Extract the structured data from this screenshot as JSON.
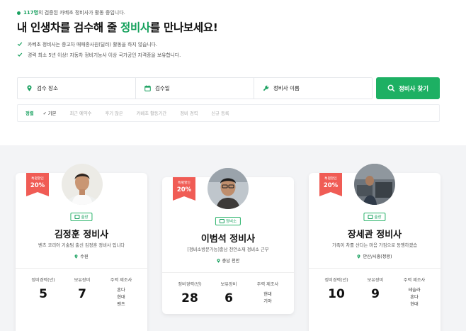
{
  "header": {
    "count_number": "117명",
    "count_suffix": "의 검증된 카베초 정비사가 활동 중입니다.",
    "headline_pre": "내 인생차를 검수해 줄 ",
    "headline_highlight": "정비사",
    "headline_post": "를 만나보세요!",
    "checks": [
      "카베초 정비사는 중고차 매매종사원(딜러) 활동을 하지 않습니다.",
      "경력 최소 5년 이상! 자동차 정비기능사 이상 국가공인 자격증을 보유합니다."
    ]
  },
  "search": {
    "location_label": "검수 장소",
    "date_label": "검수일",
    "name_label": "정비사 이름",
    "button_label": "정비사 찾기"
  },
  "sort": {
    "label": "정렬",
    "options": [
      "기본",
      "최근 예약수",
      "후기 많은",
      "카베초 활동기간",
      "정비 경력",
      "신규 등록"
    ]
  },
  "colors": {
    "brand_green": "#1db063",
    "badge_red": "#f05c55",
    "background": "#f3f4f6"
  },
  "mechanics": [
    {
      "badge_line1": "특별할인",
      "badge_line2": "20%",
      "tag": "출장",
      "name": "김정훈 정비사",
      "description": "벤츠 코리아 기술팀 출신 김정훈 정비사 입니다",
      "location": "수원",
      "career_label": "정비경력(년)",
      "career": "5",
      "equip_label": "보유장비",
      "equipment": "7",
      "makers_label": "주력 제조사",
      "makers": [
        "혼다",
        "현대",
        "벤츠"
      ]
    },
    {
      "badge_line1": "특별할인",
      "badge_line2": "20%",
      "tag": "정비소",
      "name": "이범석 정비사",
      "description": "[정비소방문가능]충남 천안소재 정비소 근무",
      "location": "충남 천안",
      "career_label": "정비경력(년)",
      "career": "28",
      "equip_label": "보유장비",
      "equipment": "6",
      "makers_label": "주력 제조사",
      "makers": [
        "현대",
        "기아"
      ]
    },
    {
      "badge_line1": "특별할인",
      "badge_line2": "20%",
      "tag": "출장",
      "name": "장세관 정비사",
      "description": "가족이 차를 산다는 마음 가짐으로 동행하겠습",
      "location": "안산/시흥(정왕)",
      "career_label": "정비경력(년)",
      "career": "10",
      "equip_label": "보유장비",
      "equipment": "9",
      "makers_label": "주력 제조사",
      "makers": [
        "테슬라",
        "혼다",
        "현대"
      ]
    }
  ]
}
